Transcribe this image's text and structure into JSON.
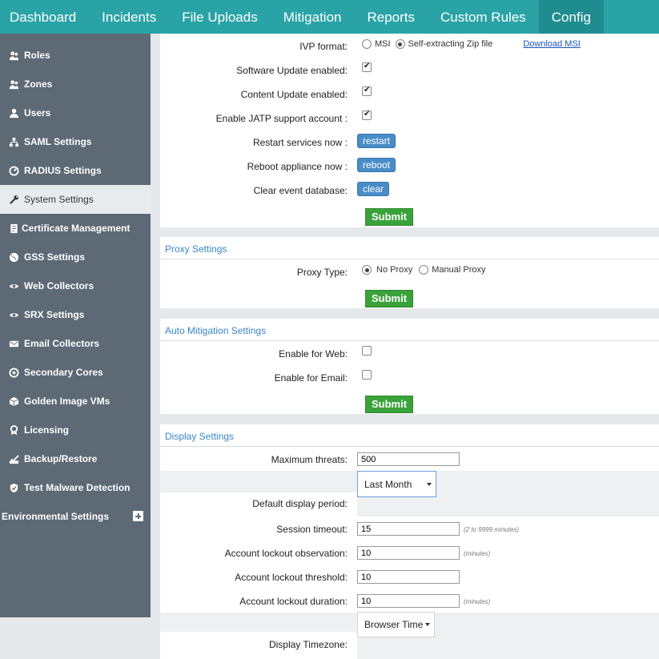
{
  "nav": {
    "tabs": [
      "Dashboard",
      "Incidents",
      "File Uploads",
      "Mitigation",
      "Reports",
      "Custom Rules",
      "Config"
    ],
    "active": "Config"
  },
  "sidebar": {
    "items": [
      {
        "label": "Roles",
        "icon": "roles-icon"
      },
      {
        "label": "Zones",
        "icon": "zones-icon"
      },
      {
        "label": "Users",
        "icon": "users-icon"
      },
      {
        "label": "SAML Settings",
        "icon": "saml-icon"
      },
      {
        "label": "RADIUS Settings",
        "icon": "radius-icon"
      },
      {
        "label": "System Settings",
        "icon": "wrench-icon"
      },
      {
        "label": "Certificate Management",
        "icon": "certificate-icon"
      },
      {
        "label": "GSS Settings",
        "icon": "globe-icon"
      },
      {
        "label": "Web Collectors",
        "icon": "eye-icon"
      },
      {
        "label": "SRX Settings",
        "icon": "eye-icon"
      },
      {
        "label": "Email Collectors",
        "icon": "email-icon"
      },
      {
        "label": "Secondary Cores",
        "icon": "cores-icon"
      },
      {
        "label": "Golden Image VMs",
        "icon": "cube-icon"
      },
      {
        "label": "Licensing",
        "icon": "award-icon"
      },
      {
        "label": "Backup/Restore",
        "icon": "backup-icon"
      },
      {
        "label": "Test Malware Detection",
        "icon": "shield-icon"
      }
    ],
    "active": "System Settings",
    "env_label": "Environmental Settings"
  },
  "system": {
    "ivp_label": "IVP format:",
    "ivp_msi": "MSI",
    "ivp_zip": "Self-extracting Zip file",
    "ivp_selected": "Self-extracting Zip file",
    "download_link": "Download MSI",
    "software_update_label": "Software Update enabled:",
    "software_update": true,
    "content_update_label": "Content Update enabled:",
    "content_update": true,
    "jatp_label": "Enable JATP support account :",
    "jatp": true,
    "restart_label": "Restart services now :",
    "restart_btn": "restart",
    "reboot_label": "Reboot appliance now :",
    "reboot_btn": "reboot",
    "clear_label": "Clear event database:",
    "clear_btn": "clear",
    "submit": "Submit"
  },
  "proxy": {
    "title": "Proxy Settings",
    "type_label": "Proxy Type:",
    "no_proxy": "No Proxy",
    "manual_proxy": "Manual Proxy",
    "selected": "No Proxy",
    "submit": "Submit"
  },
  "mitigation": {
    "title": "Auto Mitigation Settings",
    "web_label": "Enable for Web:",
    "web": false,
    "email_label": "Enable for Email:",
    "email": false,
    "submit": "Submit"
  },
  "display": {
    "title": "Display Settings",
    "max_threats_label": "Maximum threats:",
    "max_threats": "500",
    "period_value": "Last Month",
    "period_label": "Default display period:",
    "session_label": "Session timeout:",
    "session_value": "15",
    "session_hint": "(2 to 9999 minutes)",
    "lockout_obs_label": "Account lockout observation:",
    "lockout_obs_value": "10",
    "lockout_obs_hint": "(minutes)",
    "lockout_thr_label": "Account lockout threshold:",
    "lockout_thr_value": "10",
    "lockout_dur_label": "Account lockout duration:",
    "lockout_dur_value": "10",
    "lockout_dur_hint": "(minutes)",
    "timezone_value": "Browser Time",
    "timezone_label": "Display Timezone:"
  }
}
